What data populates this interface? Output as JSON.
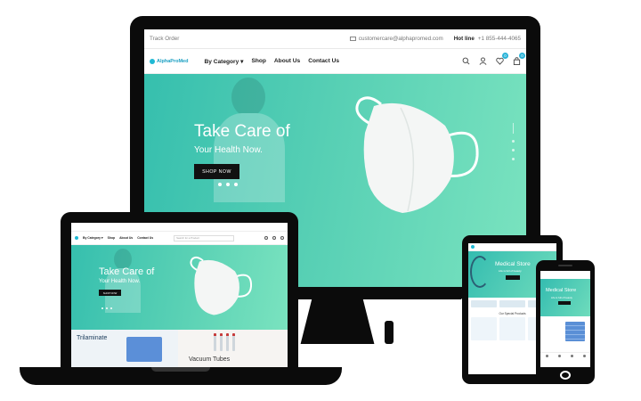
{
  "desktop": {
    "topbar": {
      "track_order": "Track Order",
      "email": "customercare@alphapromed.com",
      "hotline_label": "Hot line",
      "hotline_number": "+1 855-444-4065"
    },
    "logo_text": "AlphaProMed",
    "nav": [
      "By Category ▾",
      "Shop",
      "About Us",
      "Contact Us"
    ],
    "badges": {
      "wishlist": "0",
      "cart": "0"
    },
    "hero": {
      "title": "Take Care of",
      "subtitle": "Your Health Now.",
      "cta": "SHOP NOW"
    }
  },
  "laptop": {
    "nav": [
      "By Category ▾",
      "Shop",
      "About Us",
      "Contact Us"
    ],
    "search_placeholder": "Search for a Product",
    "hero": {
      "title": "Take Care of",
      "subtitle": "Your Health Now.",
      "cta": "SHOP NOW"
    },
    "cards": [
      {
        "title": "Trilaminate"
      },
      {
        "title": "Vacuum Tubes"
      }
    ]
  },
  "tablet": {
    "hero_title": "Medical Store",
    "hero_sub": "Life is full of beauty",
    "section_label": "Our Special Products"
  },
  "phone": {
    "hero_title": "Medical Store",
    "hero_sub": "Life is full of beauty"
  },
  "colors": {
    "accent": "#2bb3d8",
    "hero_start": "#36bfae",
    "hero_end": "#7ae3bf",
    "device": "#0b0b0b"
  }
}
